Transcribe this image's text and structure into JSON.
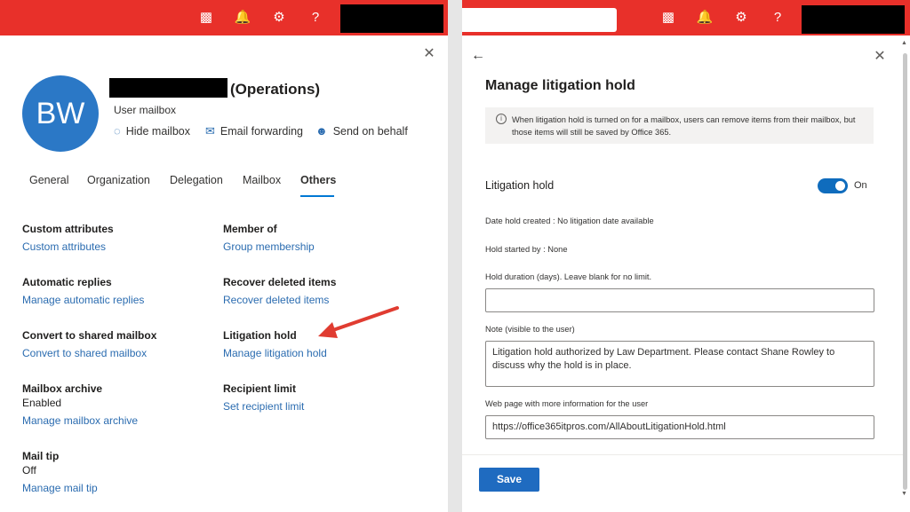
{
  "left": {
    "topbar": {
      "icons": [
        "terminal-icon",
        "bell-icon",
        "gear-icon",
        "help-icon"
      ]
    },
    "profile": {
      "initials": "BW",
      "name_suffix": "(Operations)",
      "type": "User mailbox",
      "actions": [
        {
          "label": "Hide mailbox",
          "icon": "eye-hide-icon"
        },
        {
          "label": "Email forwarding",
          "icon": "mail-forward-icon"
        },
        {
          "label": "Send on behalf",
          "icon": "person-icon"
        }
      ]
    },
    "tabs": [
      "General",
      "Organization",
      "Delegation",
      "Mailbox",
      "Others"
    ],
    "active_tab": "Others",
    "sections": {
      "custom_attributes": {
        "title": "Custom attributes",
        "link": "Custom attributes"
      },
      "member_of": {
        "title": "Member of",
        "link": "Group membership"
      },
      "automatic_replies": {
        "title": "Automatic replies",
        "link": "Manage automatic replies"
      },
      "recover_deleted": {
        "title": "Recover deleted items",
        "link": "Recover deleted items"
      },
      "convert_shared": {
        "title": "Convert to shared mailbox",
        "link": "Convert to shared mailbox"
      },
      "litigation_hold": {
        "title": "Litigation hold",
        "link": "Manage litigation hold"
      },
      "mailbox_archive": {
        "title": "Mailbox archive",
        "value": "Enabled",
        "link": "Manage mailbox archive"
      },
      "recipient_limit": {
        "title": "Recipient limit",
        "link": "Set recipient limit"
      },
      "mail_tip": {
        "title": "Mail tip",
        "value": "Off",
        "link": "Manage mail tip"
      }
    }
  },
  "right": {
    "title": "Manage litigation hold",
    "info": "When litigation hold is turned on for a mailbox, users can remove items from their mailbox, but those items will still be saved by Office 365.",
    "litigation_hold_label": "Litigation hold",
    "toggle_state": "On",
    "date_created": "Date hold created : No litigation date available",
    "started_by": "Hold started by : None",
    "duration_label": "Hold duration (days). Leave blank for no limit.",
    "duration_value": "",
    "note_label": "Note (visible to the user)",
    "note_value": "Litigation hold authorized by Law Department. Please contact Shane Rowley to discuss why the hold is in place.",
    "webpage_label": "Web page with more information for the user",
    "webpage_value": "https://office365itpros.com/AllAboutLitigationHold.html",
    "save_label": "Save"
  },
  "colors": {
    "topbar": "#e8302a",
    "accent": "#0078d4",
    "link": "#2b6cb0",
    "avatar": "#2b78c6",
    "annotation_arrow": "#e03c31"
  }
}
